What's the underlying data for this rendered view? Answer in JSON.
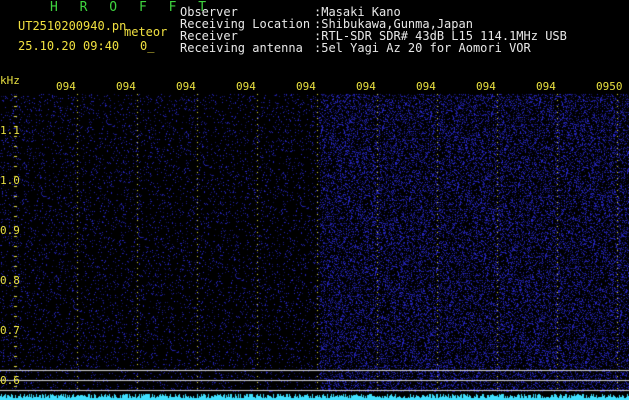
{
  "header": {
    "brand": "H R O F F T",
    "filename": "UT2510200940.pn",
    "mode": "meteor",
    "timestamp": "25.10.20 09:40",
    "counter": "0_",
    "observer_label": "Observer",
    "observer_value": ":Masaki Kano",
    "location_label": "Receiving Location",
    "location_value": ":Shibukawa,Gunma,Japan",
    "receiver_label": "Receiver",
    "receiver_value": ":RTL-SDR SDR# 43dB L15 114.1MHz USB",
    "antenna_label": "Receiving antenna",
    "antenna_value": ":5el Yagi Az 20 for Aomori VOR"
  },
  "axis": {
    "unit": "kHz",
    "y_ticks": [
      "1.1",
      "1.0",
      "0.9",
      "0.8",
      "0.7",
      "0.6"
    ],
    "x_ticks": [
      "094",
      "094",
      "094",
      "094",
      "094",
      "094",
      "094",
      "094",
      "094",
      "0950"
    ]
  },
  "colors": {
    "tick_yellow": "#e8e040",
    "noise_blue": "#2a2acc",
    "trace_cyan": "#40e0ff"
  }
}
